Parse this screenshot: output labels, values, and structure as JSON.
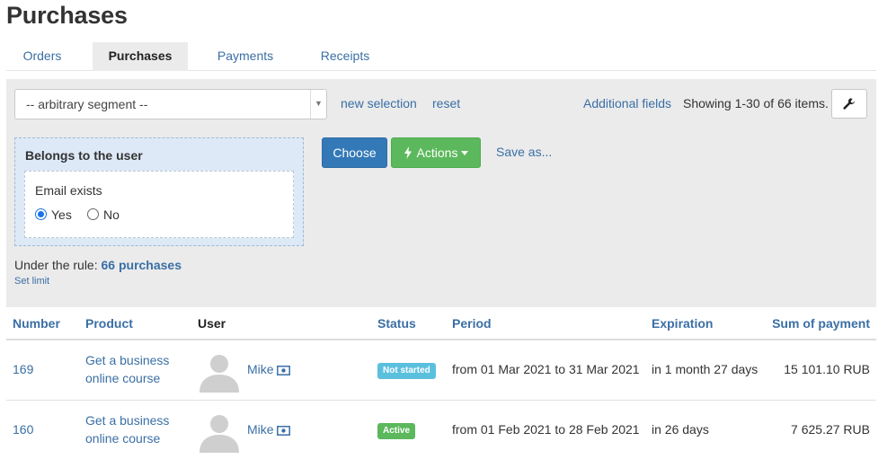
{
  "page": {
    "title": "Purchases"
  },
  "tabs": [
    {
      "label": "Orders",
      "active": false
    },
    {
      "label": "Purchases",
      "active": true
    },
    {
      "label": "Payments",
      "active": false
    },
    {
      "label": "Receipts",
      "active": false
    }
  ],
  "filter": {
    "segment_value": "-- arbitrary segment --",
    "new_selection_label": "new selection",
    "reset_label": "reset",
    "additional_fields_label": "Additional fields",
    "showing_text": "Showing 1-30 of 66 items.",
    "settings_icon": "wrench-icon",
    "rule": {
      "title": "Belongs to the user",
      "condition_label": "Email exists",
      "options": [
        {
          "label": "Yes",
          "checked": true
        },
        {
          "label": "No",
          "checked": false
        }
      ]
    },
    "choose_label": "Choose",
    "actions_label": "Actions",
    "save_as_label": "Save as...",
    "rule_summary_prefix": "Under the rule:",
    "rule_summary_count": "66 purchases",
    "set_limit_label": "Set limit"
  },
  "table": {
    "headers": {
      "number": "Number",
      "product": "Product",
      "user": "User",
      "status": "Status",
      "period": "Period",
      "expiration": "Expiration",
      "sum": "Sum of payment"
    },
    "rows": [
      {
        "number": "169",
        "product_line1": "Get a business",
        "product_line2": "online course",
        "user": "Mike",
        "status": "Not started",
        "status_color": "#5bc0de",
        "period": "from 01 Mar 2021 to 31 Mar 2021",
        "expiration": "in 1 month 27 days",
        "sum": "15 101.10 RUB"
      },
      {
        "number": "160",
        "product_line1": "Get a business",
        "product_line2": "online course",
        "user": "Mike",
        "status": "Active",
        "status_color": "#5cb85c",
        "period": "from 01 Feb 2021 to 28 Feb 2021",
        "expiration": "in 26 days",
        "sum": "7 625.27 RUB"
      }
    ]
  },
  "colors": {
    "link": "#3a6fa5",
    "primary": "#3379b7",
    "success": "#5cb85c",
    "info": "#5bc0de"
  }
}
